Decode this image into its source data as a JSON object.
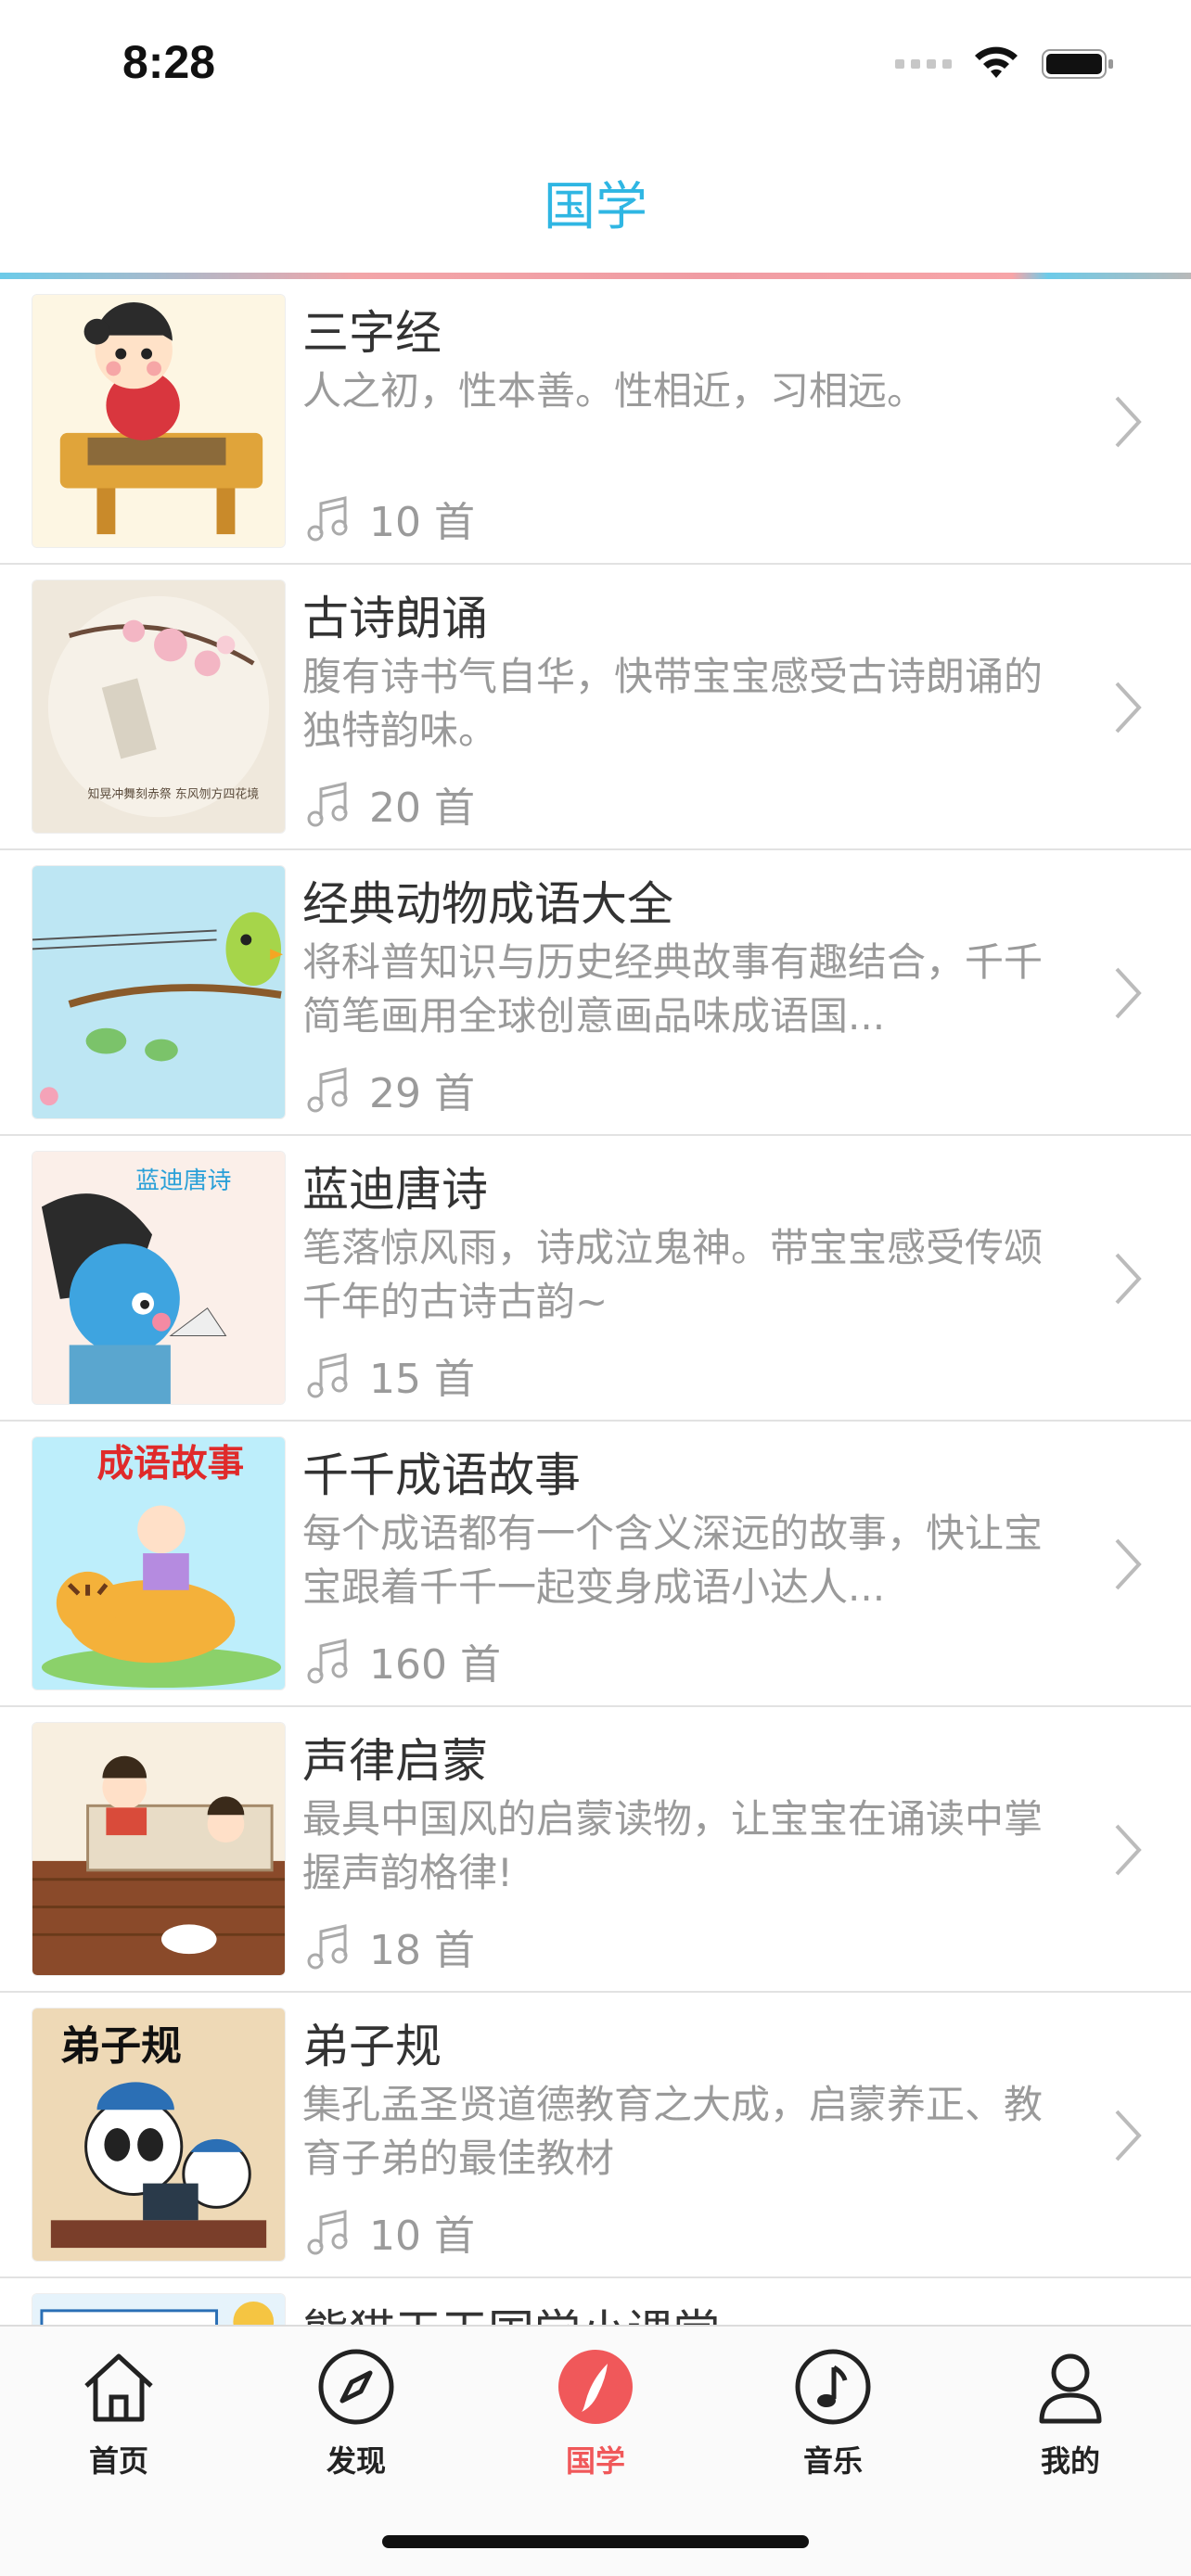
{
  "status_bar": {
    "time": "8:28"
  },
  "header": {
    "title": "国学"
  },
  "colors": {
    "title_accent": "#2fb6e3",
    "active_tab": "#f0585a",
    "desc_text": "#9a9a9a"
  },
  "items": [
    {
      "title": "三字经",
      "description": "人之初，性本善。性相近，习相远。",
      "count": "10 首"
    },
    {
      "title": "古诗朗诵",
      "description": "腹有诗书气自华，快带宝宝感受古诗朗诵的独特韵味。",
      "count": "20 首",
      "thumb_text": "知晃冲舞刻赤祭 东风刎方四花境"
    },
    {
      "title": "经典动物成语大全",
      "description": "将科普知识与历史经典故事有趣结合，千千简笔画用全球创意画品味成语国...",
      "count": "29 首"
    },
    {
      "title": "蓝迪唐诗",
      "description": "笔落惊风雨，诗成泣鬼神。带宝宝感受传颂千年的古诗古韵~",
      "count": "15 首",
      "thumb_text": "蓝迪唐诗"
    },
    {
      "title": "千千成语故事",
      "description": "每个成语都有一个含义深远的故事，快让宝宝跟着千千一起变身成语小达人...",
      "count": "160 首",
      "thumb_text": "成语故事"
    },
    {
      "title": "声律启蒙",
      "description": "最具中国风的启蒙读物，让宝宝在诵读中掌握声韵格律!",
      "count": "18 首"
    },
    {
      "title": "弟子规",
      "description": "集孔孟圣贤道德教育之大成，启蒙养正、教育子弟的最佳教材",
      "count": "10 首",
      "thumb_text": "弟子规"
    },
    {
      "title": "熊猫天天国学小课堂",
      "description": "",
      "count": ""
    }
  ],
  "tabs": [
    {
      "label": "首页",
      "icon": "home-icon"
    },
    {
      "label": "发现",
      "icon": "compass-icon"
    },
    {
      "label": "国学",
      "icon": "brush-icon",
      "active": true
    },
    {
      "label": "音乐",
      "icon": "music-note-icon"
    },
    {
      "label": "我的",
      "icon": "person-icon"
    }
  ]
}
